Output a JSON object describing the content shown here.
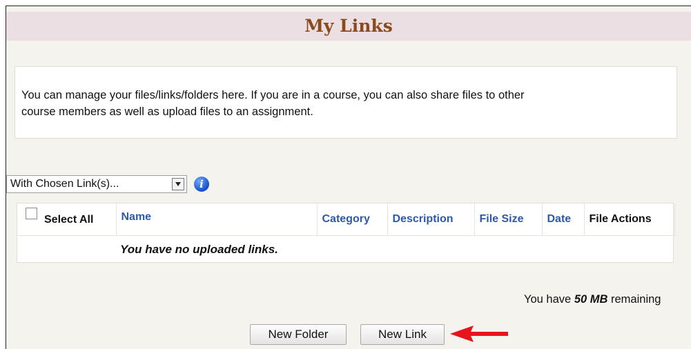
{
  "page": {
    "title": "My Links",
    "intro_text": "You can manage your files/links/folders here. If you are in a course, you can also share files to other course members as well as upload files to an assignment."
  },
  "bulk_action": {
    "selected": "With Chosen Link(s)...",
    "info_icon": "info-icon"
  },
  "table": {
    "columns": {
      "select_all": "Select All",
      "name": "Name",
      "category": "Category",
      "description": "Description",
      "file_size": "File Size",
      "date": "Date",
      "file_actions": "File Actions"
    },
    "empty_message": "You have no uploaded links."
  },
  "storage": {
    "prefix": "You have",
    "amount": "50 MB",
    "suffix": "remaining"
  },
  "buttons": {
    "new_folder": "New Folder",
    "new_link": "New Link"
  },
  "colors": {
    "header_band": "#ecdfe3",
    "title": "#8a4b1c",
    "column_link": "#2d5aa8",
    "annotation_arrow": "#e8141c"
  }
}
